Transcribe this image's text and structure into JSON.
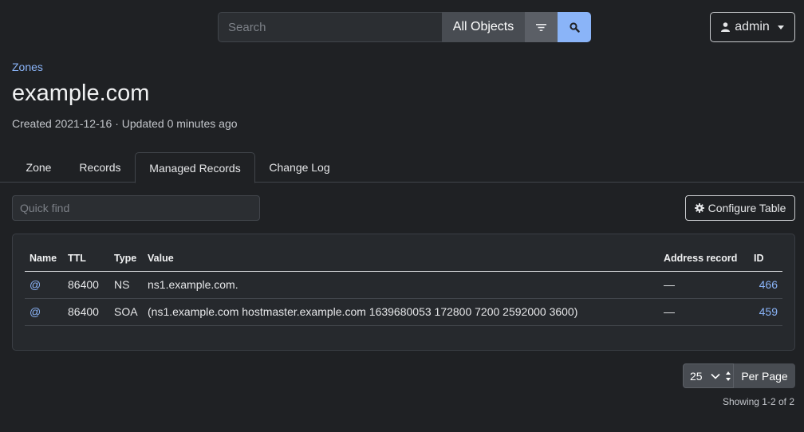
{
  "topbar": {
    "search_placeholder": "Search",
    "scope_label": "All Objects",
    "user_label": "admin"
  },
  "header": {
    "breadcrumb": "Zones",
    "title": "example.com",
    "subtitle": "Created 2021-12-16 · Updated 0 minutes ago"
  },
  "tabs": [
    {
      "label": "Zone",
      "active": false
    },
    {
      "label": "Records",
      "active": false
    },
    {
      "label": "Managed Records",
      "active": true
    },
    {
      "label": "Change Log",
      "active": false
    }
  ],
  "toolbar": {
    "quickfind_placeholder": "Quick find",
    "configure_label": "Configure Table"
  },
  "table": {
    "columns": [
      "Name",
      "TTL",
      "Type",
      "Value",
      "Address record",
      "ID"
    ],
    "rows": [
      {
        "name": "@",
        "ttl": "86400",
        "type": "NS",
        "value": "ns1.example.com.",
        "address_record": "—",
        "id": "466"
      },
      {
        "name": "@",
        "ttl": "86400",
        "type": "SOA",
        "value": "(ns1.example.com hostmaster.example.com 1639680053 172800 7200 2592000 3600)",
        "address_record": "—",
        "id": "459"
      }
    ]
  },
  "pagination": {
    "per_page_value": "25",
    "per_page_label": "Per Page",
    "showing": "Showing 1-2 of 2"
  },
  "colors": {
    "background": "#1f2124",
    "accent": "#8ab4f8",
    "button": "#484c52"
  }
}
